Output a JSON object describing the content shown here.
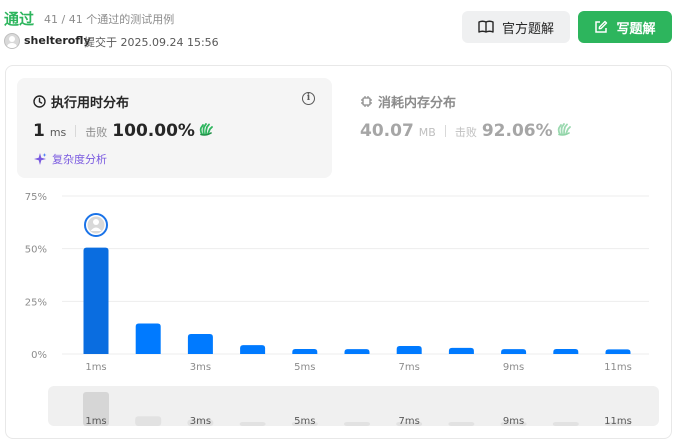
{
  "header": {
    "status": "通过",
    "cases": "41 / 41 个通过的测试用例",
    "username": "shelterofly",
    "submitted": "提交于 2025.09.24 15:56",
    "official_solution": "官方题解",
    "write_solution": "写题解"
  },
  "runtime_card": {
    "title": "执行用时分布",
    "value": "1",
    "unit": "ms",
    "beats_label": "击败",
    "percent": "100.00%",
    "complexity": "复杂度分析"
  },
  "memory_card": {
    "title": "消耗内存分布",
    "value": "40.07",
    "unit": "MB",
    "beats_label": "击败",
    "percent": "92.06%"
  },
  "colors": {
    "accent_green": "#2db55d",
    "bar_blue": "#007aff",
    "bar_highlight": "#0a6de0",
    "purple": "#7a5ae0"
  },
  "chart_data": {
    "type": "bar",
    "yticks": [
      "0%",
      "25%",
      "50%",
      "75%"
    ],
    "ylim": [
      0,
      75
    ],
    "x_tick_labels": [
      "1ms",
      "",
      "3ms",
      "",
      "5ms",
      "",
      "7ms",
      "",
      "9ms",
      "",
      "11ms"
    ],
    "categories": [
      "1ms",
      "2ms",
      "3ms",
      "4ms",
      "5ms",
      "6ms",
      "7ms",
      "8ms",
      "9ms",
      "10ms",
      "11ms"
    ],
    "values": [
      50.5,
      14.5,
      9.5,
      4.2,
      2.4,
      2.3,
      3.8,
      2.9,
      2.3,
      2.4,
      2.2
    ],
    "highlight_index": 0,
    "grid": true
  },
  "minimap": {
    "labels": [
      "1ms",
      "3ms",
      "5ms",
      "7ms",
      "9ms",
      "11ms"
    ]
  }
}
